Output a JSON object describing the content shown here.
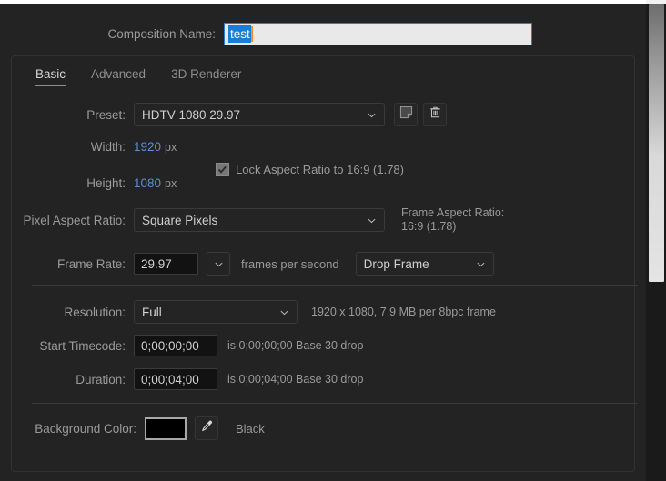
{
  "dialog": {
    "composition_name_label": "Composition Name:",
    "composition_name_value": "test"
  },
  "tabs": [
    {
      "label": "Basic",
      "active": true
    },
    {
      "label": "Advanced",
      "active": false
    },
    {
      "label": "3D Renderer",
      "active": false
    }
  ],
  "fields": {
    "preset_label": "Preset:",
    "preset_value": "HDTV 1080 29.97",
    "width_label": "Width:",
    "width_value": "1920",
    "width_unit": "px",
    "height_label": "Height:",
    "height_value": "1080",
    "height_unit": "px",
    "lock_aspect_label": "Lock Aspect Ratio to 16:9 (1.78)",
    "lock_aspect_checked": true,
    "pixel_aspect_label": "Pixel Aspect Ratio:",
    "pixel_aspect_value": "Square Pixels",
    "frame_aspect_label": "Frame Aspect Ratio:",
    "frame_aspect_value": "16:9 (1.78)",
    "frame_rate_label": "Frame Rate:",
    "frame_rate_value": "29.97",
    "frame_rate_unit": "frames per second",
    "drop_frame_value": "Drop Frame",
    "resolution_label": "Resolution:",
    "resolution_value": "Full",
    "resolution_info": "1920 x 1080, 7.9 MB per 8bpc frame",
    "start_timecode_label": "Start Timecode:",
    "start_timecode_value": "0;00;00;00",
    "start_timecode_info": "is 0;00;00;00  Base 30  drop",
    "duration_label": "Duration:",
    "duration_value": "0;00;04;00",
    "duration_info": "is 0;00;04;00  Base 30  drop",
    "background_color_label": "Background Color:",
    "background_color_swatch": "#000000",
    "background_color_name": "Black"
  },
  "icons": {
    "save_preset": "new-preset-icon",
    "delete_preset": "trash-icon",
    "eyedropper": "eyedropper-icon",
    "chevron": "chevron-down-icon"
  },
  "colors": {
    "accent_blue": "#5b8fd4",
    "focus_border": "#2d7dd2",
    "selection": "#1a7fd4",
    "caret": "#ff8c28",
    "panel_bg": "#232323"
  }
}
